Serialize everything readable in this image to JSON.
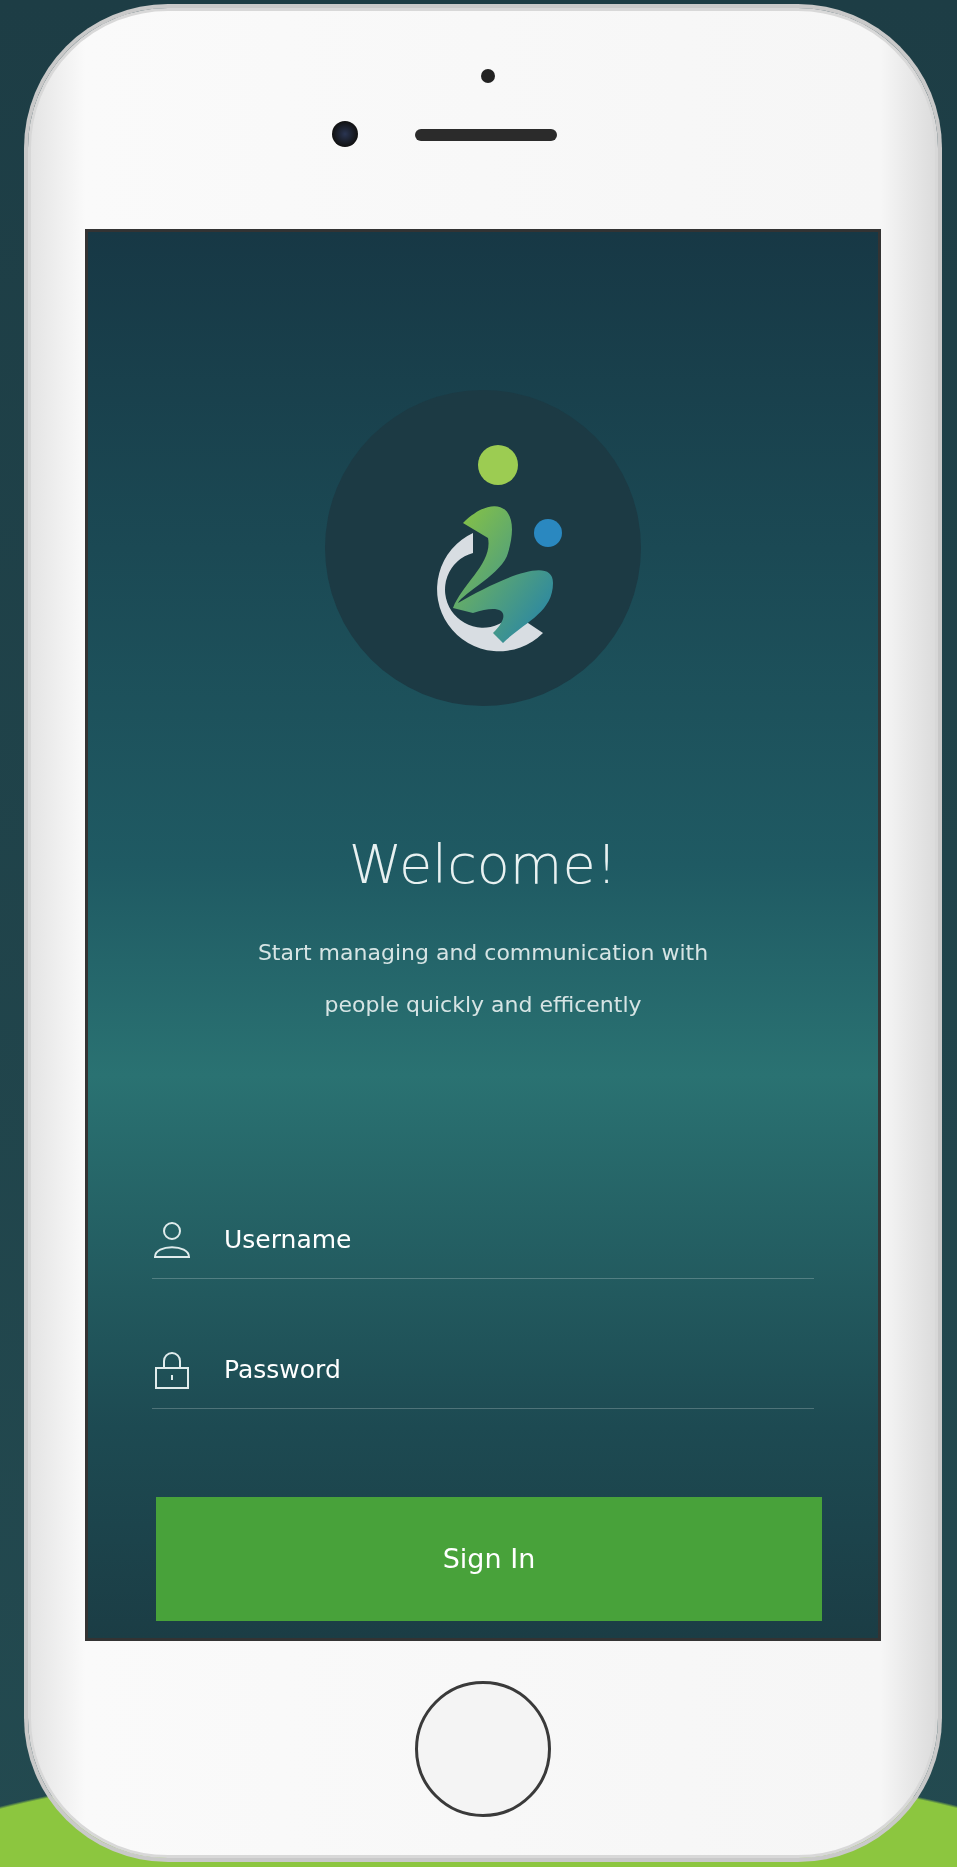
{
  "screen": {
    "title": "Welcome!",
    "subtitle": "Start managing and communication with people quickly and efficently",
    "fields": [
      {
        "kind": "user",
        "placeholder": "Username"
      },
      {
        "kind": "password",
        "placeholder": "Password"
      }
    ],
    "button": "Sign In"
  }
}
